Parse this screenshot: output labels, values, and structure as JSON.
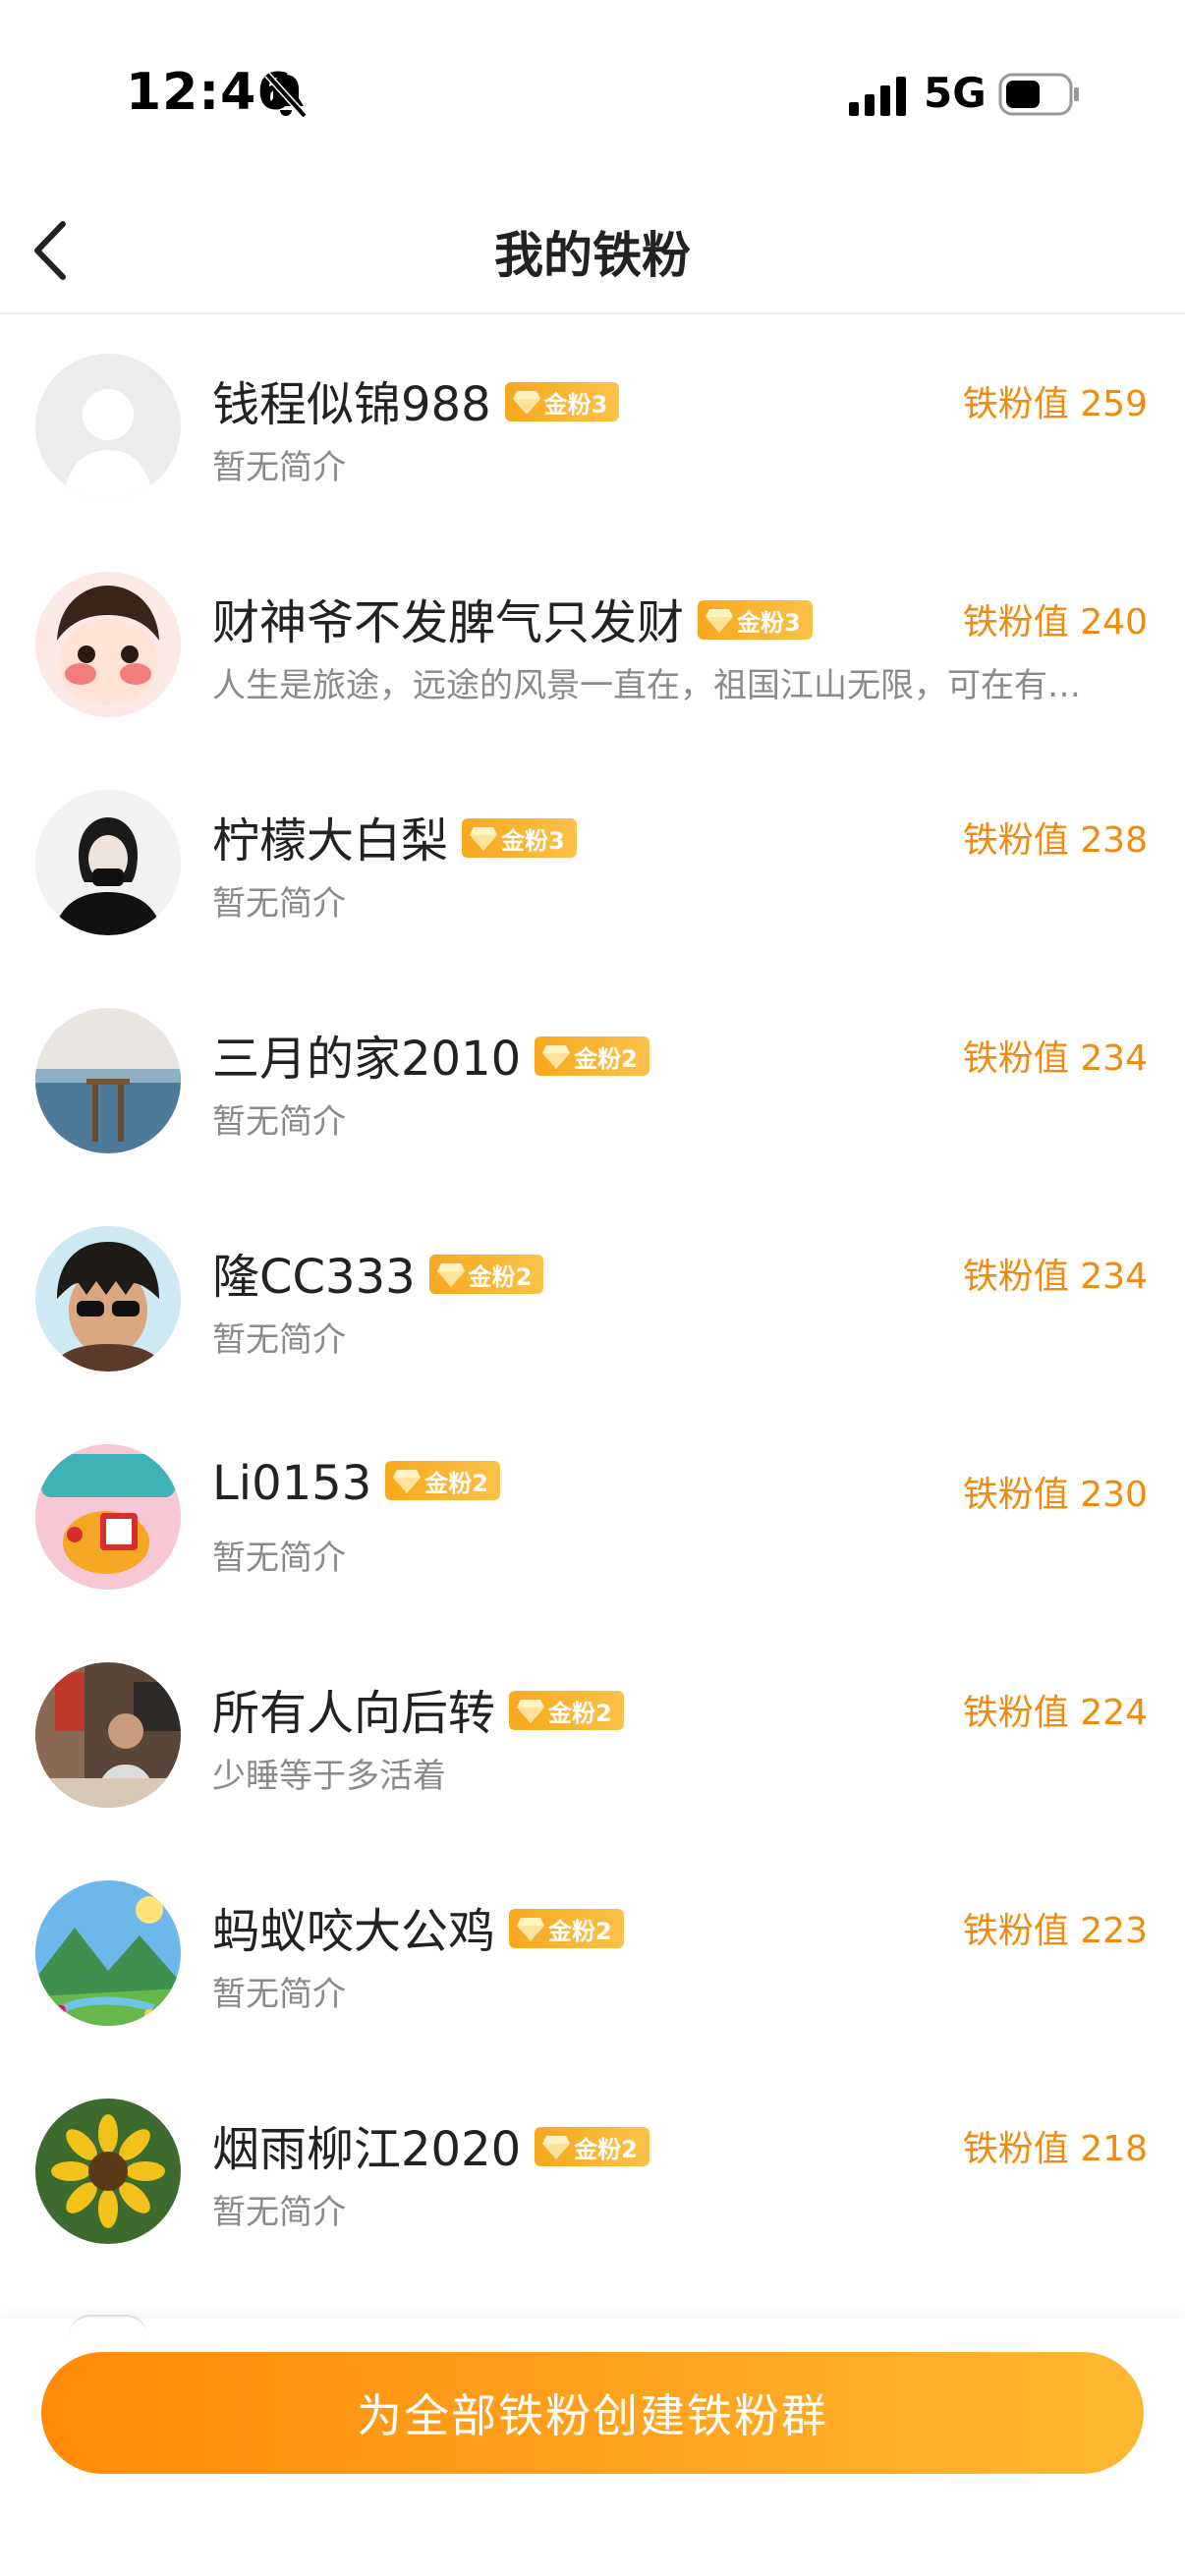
{
  "status_bar": {
    "time": "12:46",
    "network": "5G",
    "icons": [
      "bell-slash-icon",
      "signal-icon",
      "battery-icon"
    ]
  },
  "nav": {
    "title": "我的铁粉",
    "back_icon": "chevron-left-icon"
  },
  "fans": [
    {
      "name": "钱程似锦988",
      "badge": "金粉3",
      "bio": "暂无简介",
      "score": "铁粉值 259"
    },
    {
      "name": "财神爷不发脾气只发财",
      "badge": "金粉3",
      "bio": "人生是旅途，远途的风景一直在，祖国江山无限，可在有…",
      "score": "铁粉值 240"
    },
    {
      "name": "柠檬大白梨",
      "badge": "金粉3",
      "bio": "暂无简介",
      "score": "铁粉值 238"
    },
    {
      "name": "三月的家2010",
      "badge": "金粉2",
      "bio": "暂无简介",
      "score": "铁粉值 234"
    },
    {
      "name": "隆CC333",
      "badge": "金粉2",
      "bio": "暂无简介",
      "score": "铁粉值 234"
    },
    {
      "name": "Li0153",
      "badge": "金粉2",
      "bio": "暂无简介",
      "score": "铁粉值 230"
    },
    {
      "name": "所有人向后转",
      "badge": "金粉2",
      "bio": "少睡等于多活着",
      "score": "铁粉值 224"
    },
    {
      "name": "蚂蚁咬大公鸡",
      "badge": "金粉2",
      "bio": "暂无简介",
      "score": "铁粉值 223"
    },
    {
      "name": "烟雨柳江2020",
      "badge": "金粉2",
      "bio": "暂无简介",
      "score": "铁粉值 218"
    }
  ],
  "cta": {
    "label": "为全部铁粉创建铁粉群"
  },
  "colors": {
    "accent": "#f28a0c",
    "badge": "#f7a81d",
    "cta_start": "#ff8a08",
    "cta_end": "#ffb832"
  }
}
